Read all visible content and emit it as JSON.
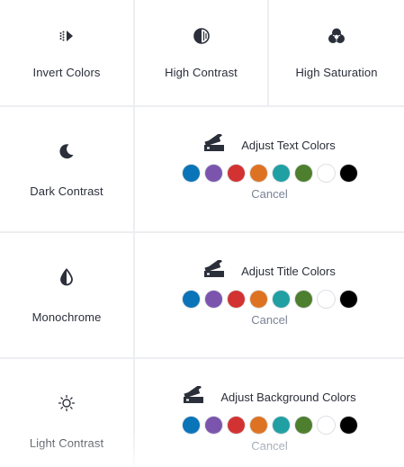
{
  "tiles": {
    "invert": {
      "label": "Invert Colors",
      "icon": "invert-colors-icon"
    },
    "high_contrast": {
      "label": "High Contrast",
      "icon": "high-contrast-icon"
    },
    "high_saturation": {
      "label": "High Saturation",
      "icon": "high-saturation-icon"
    },
    "dark_contrast": {
      "label": "Dark Contrast",
      "icon": "moon-icon"
    },
    "monochrome": {
      "label": "Monochrome",
      "icon": "droplet-icon"
    },
    "light_contrast": {
      "label": "Light Contrast",
      "icon": "sun-icon"
    }
  },
  "color_panels": {
    "text": {
      "title": "Adjust Text Colors",
      "cancel": "Cancel",
      "icon": "color-swatch-icon"
    },
    "title": {
      "title": "Adjust Title Colors",
      "cancel": "Cancel",
      "icon": "color-swatch-icon"
    },
    "background": {
      "title": "Adjust Background Colors",
      "cancel": "Cancel",
      "icon": "color-swatch-icon"
    }
  },
  "swatch_colors": [
    "#0a74b8",
    "#7b55ad",
    "#d23232",
    "#dd7322",
    "#21a0a3",
    "#4d7f2e",
    "#ffffff",
    "#000000"
  ],
  "theme": {
    "text": "#2b2f3a",
    "muted": "#7a8394",
    "border": "#eceef1"
  }
}
